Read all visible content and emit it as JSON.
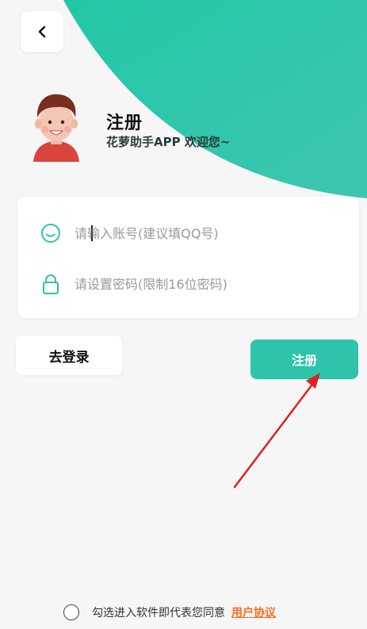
{
  "header": {
    "back_icon": "chevron-left-icon",
    "title": "注册",
    "subtitle": "花萝助手APP 欢迎您~"
  },
  "form": {
    "account_placeholder": "请输入账号(建议填QQ号)",
    "account_icon": "smile-icon",
    "password_placeholder": "请设置密码(限制16位密码)",
    "password_icon": "lock-icon"
  },
  "actions": {
    "login_label": "去登录",
    "register_label": "注册"
  },
  "agreement": {
    "text": "勾选进入软件即代表您同意",
    "link_label": "用户协议"
  },
  "colors": {
    "accent": "#2ec4a9",
    "link": "#ff6a1a",
    "annotation_arrow": "#e02020"
  }
}
